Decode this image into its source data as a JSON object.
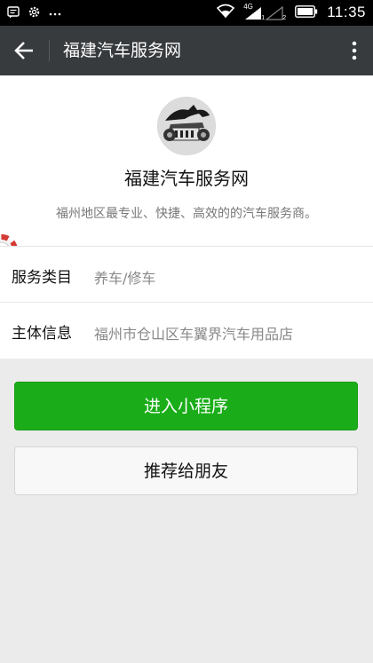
{
  "status_bar": {
    "time": "11:35",
    "network_label": "4G",
    "signal_sub_1": "1",
    "signal_sub_2": "2",
    "icons": [
      "message-icon",
      "settings-icon",
      "more-dots-icon",
      "wifi-icon",
      "signal-icon",
      "battery-icon"
    ]
  },
  "title_bar": {
    "title": "福建汽车服务网",
    "back_icon": "back-arrow-icon",
    "more_icon": "more-vertical-icon"
  },
  "profile": {
    "name": "福建汽车服务网",
    "description": "福州地区最专业、快捷、高效的的汽车服务商。"
  },
  "info": {
    "service_label": "服务类目",
    "service_value": "养车/修车",
    "subject_label": "主体信息",
    "subject_value": "福州市仓山区车翼界汽车用品店"
  },
  "buttons": {
    "enter": "进入小程序",
    "recommend": "推荐给朋友"
  },
  "colors": {
    "status_bar": "#000000",
    "title_bar": "#383b3e",
    "primary_button": "#1aad19",
    "background": "#ebebeb"
  }
}
